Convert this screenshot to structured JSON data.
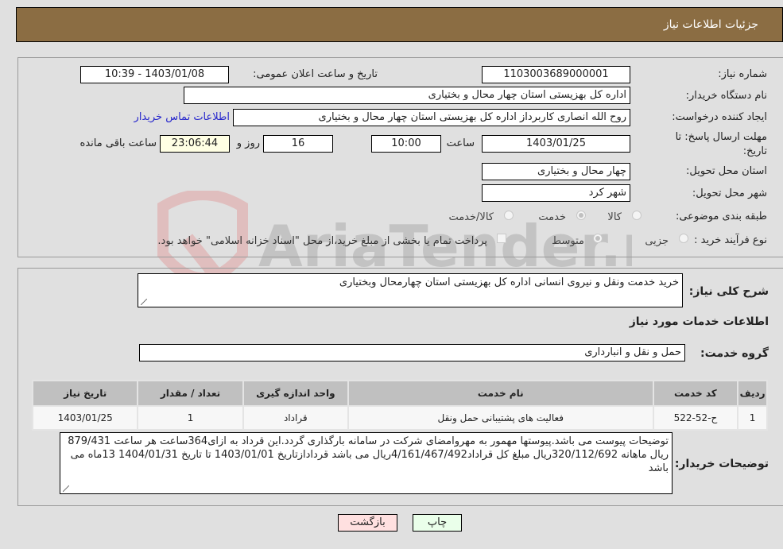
{
  "header": {
    "title": "جزئيات اطلاعات نياز"
  },
  "details": {
    "need_number_label": "شماره نیاز:",
    "need_number": "1103003689000001",
    "announce_label": "تاریخ و ساعت اعلان عمومی:",
    "announce_value": "1403/01/08 - 10:39",
    "buyer_org_label": "نام دستگاه خریدار:",
    "buyer_org": "اداره کل بهزیستی استان چهار محال و بختیاری",
    "creator_label": "ایجاد کننده درخواست:",
    "creator": "روح الله انصاری کاربرداز اداره کل بهزیستی استان چهار محال و بختیاری",
    "buyer_contact_link": "اطلاعات تماس خریدار",
    "deadline_label": "مهلت ارسال پاسخ: تا تاریخ:",
    "deadline_date": "1403/01/25",
    "time_label": "ساعت",
    "deadline_time": "10:00",
    "days_remaining": "16",
    "days_label": "روز و",
    "time_remaining": "23:06:44",
    "remaining_label": "ساعت باقی مانده",
    "province_label": "استان محل تحویل:",
    "province": "چهار محال و بختیاری",
    "city_label": "شهر محل تحویل:",
    "city": "شهر کرد",
    "category_label": "طبقه بندی موضوعی:",
    "category_options": [
      "کالا",
      "خدمت",
      "کالا/خدمت"
    ],
    "category_selected": "خدمت",
    "process_label": "نوع فرآیند خرید :",
    "process_options": [
      "جزیی",
      "متوسط"
    ],
    "process_selected": "متوسط",
    "payment_note": "پرداخت تمام یا بخشی از مبلغ خرید،از محل \"اسناد خزانه اسلامی\" خواهد بود."
  },
  "summary": {
    "description_label": "شرح کلی نیاز:",
    "description": "خرید خدمت ونقل و نیروی انسانی اداره کل بهزیستی استان چهارمحال وبختیاری",
    "services_heading": "اطلاعات خدمات مورد نیاز",
    "service_group_label": "گروه خدمت:",
    "service_group": "حمل و نقل و انبارداری"
  },
  "table": {
    "headers": [
      "ردیف",
      "کد خدمت",
      "نام خدمت",
      "واحد اندازه گیری",
      "تعداد / مقدار",
      "تاریخ نیاز"
    ],
    "rows": [
      [
        "1",
        "ح-52-522",
        "فعالیت های پشتیبانی حمل ونقل",
        "قراداد",
        "1",
        "1403/01/25"
      ]
    ]
  },
  "buyer_notes": {
    "label": "توضیحات خریدار:",
    "text": "توضیحات پیوست می باشد.پیوستها مهمور به مهروامضای شرکت در سامانه بارگذاری گردد.این قرداد به ازای364ساعت هر ساعت  879/431 ریال ماهانه 320/112/692ریال مبلغ کل قراداد4/161/467/492ریال می باشد قردادازتاریخ 1403/01/01 تا تاریخ 1404/01/31 13ماه می باشد"
  },
  "buttons": {
    "print": "چاپ",
    "back": "بازگشت"
  },
  "watermark": "AriaTender.neT",
  "colors": {
    "header_bg": "#8b6d43",
    "print_bg": "#eaffea",
    "back_bg": "#ffe0e0",
    "link": "#2626cc"
  }
}
